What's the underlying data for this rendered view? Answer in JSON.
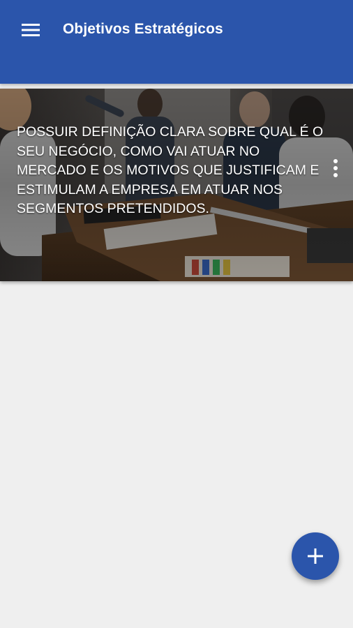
{
  "app_bar": {
    "title": "Objetivos Estratégicos",
    "menu_icon": "hamburger-menu-icon",
    "background_color": "#2b55ab"
  },
  "objectives": [
    {
      "text": "POSSUIR DEFINIÇÃO CLARA SOBRE QUAL É O SEU NEGÓCIO, COMO VAI ATUAR NO MERCADO E OS MOTIVOS QUE JUSTIFICAM E ESTIMULAM A EMPRESA EM ATUAR NOS SEGMENTOS PRETENDIDOS.",
      "background_image": "office-meeting-photo",
      "more_icon": "more-vertical-icon"
    }
  ],
  "fab": {
    "icon": "plus-icon",
    "color": "#2b55ab"
  },
  "page_background": "#efefef"
}
